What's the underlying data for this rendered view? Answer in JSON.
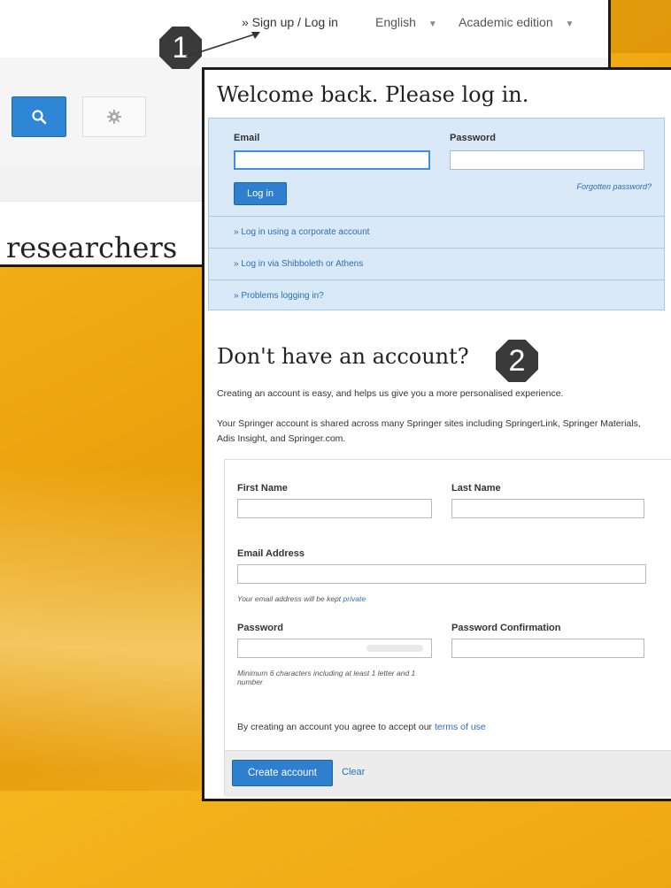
{
  "header": {
    "signup_login": "» Sign up / Log in",
    "language": "English",
    "edition": "Academic edition",
    "researchers_text": "researchers"
  },
  "badges": {
    "one": "1",
    "two": "2"
  },
  "login": {
    "title": "Welcome back. Please log in.",
    "email_label": "Email",
    "password_label": "Password",
    "login_button": "Log in",
    "forgotten_password": "Forgotten password?",
    "corporate": "» Log in using a corporate account",
    "shibboleth": "» Log in via Shibboleth or Athens",
    "problems": "» Problems logging in?"
  },
  "signup": {
    "title": "Don't have an account?",
    "intro": "Creating an account is easy, and helps us give you a more personalised experience.",
    "shared": "Your Springer account is shared across many Springer sites including SpringerLink, Springer Materials, Adis Insight, and Springer.com.",
    "first_name_label": "First Name",
    "last_name_label": "Last Name",
    "email_label": "Email Address",
    "email_hint": "Your email address will be kept",
    "email_hint_link": "private",
    "password_label": "Password",
    "password_confirm_label": "Password Confirmation",
    "password_hint": "Minimum 6 characters including at least 1 letter and 1 number",
    "terms_text": "By creating an account you agree to accept our",
    "terms_link": "terms of use",
    "create_button": "Create account",
    "clear_link": "Clear"
  },
  "colors": {
    "accent": "#2f7fcf",
    "panel": "#d9e9f8",
    "background": "#f0a812"
  }
}
